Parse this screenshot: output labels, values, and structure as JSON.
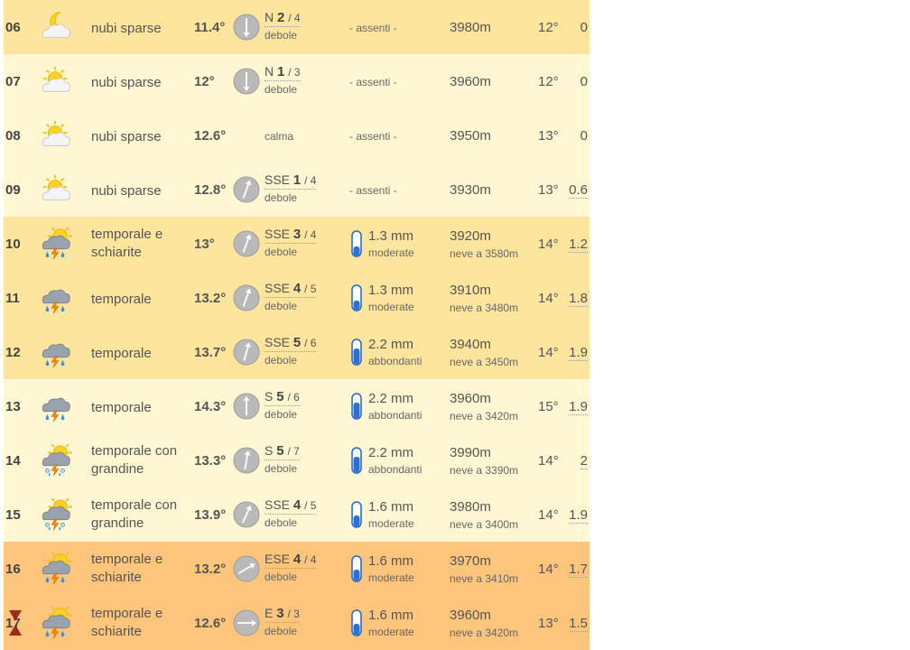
{
  "rows": [
    {
      "hour": "06",
      "icon": "moon-cloud-icon",
      "desc": "nubi sparse",
      "temp": "11.4°",
      "wind_angle": 180,
      "wind_dir": "N",
      "wind_speed": "2",
      "wind_gust": "/ 4",
      "wind_label": "debole",
      "rain": "- assenti -",
      "freeze": "3980m",
      "perc": "12°",
      "extra": "0",
      "tone": "t-gold"
    },
    {
      "hour": "07",
      "icon": "sun-cloud-icon",
      "desc": "nubi sparse",
      "temp": "12°",
      "wind_angle": 180,
      "wind_dir": "N",
      "wind_speed": "1",
      "wind_gust": "/ 3",
      "wind_label": "debole",
      "rain": "- assenti -",
      "freeze": "3960m",
      "perc": "12°",
      "extra": "0",
      "tone": "t-pale"
    },
    {
      "hour": "08",
      "icon": "sun-cloud-icon",
      "desc": "nubi sparse",
      "temp": "12.6°",
      "calm": "calma",
      "rain": "- assenti -",
      "freeze": "3950m",
      "perc": "13°",
      "extra": "0",
      "tone": "t-pale"
    },
    {
      "hour": "09",
      "icon": "sun-cloud-icon",
      "desc": "nubi sparse",
      "temp": "12.8°",
      "wind_angle": 20,
      "wind_dir": "SSE",
      "wind_speed": "1",
      "wind_gust": "/ 4",
      "wind_label": "debole",
      "rain": "- assenti -",
      "freeze": "3930m",
      "perc": "13°",
      "extra": "0.6",
      "extra_dotted": true,
      "tone": "t-pale"
    },
    {
      "hour": "10",
      "icon": "sun-storm-icon",
      "desc": "temporale e schiarite",
      "temp": "13°",
      "wind_angle": 20,
      "wind_dir": "SSE",
      "wind_speed": "3",
      "wind_gust": "/ 4",
      "wind_label": "debole",
      "rain_amt": "1.3 mm",
      "rain_int": "moderate",
      "rain_level": 0.4,
      "freeze": "3920m",
      "snow": "neve a 3580m",
      "perc": "14°",
      "extra": "1.2",
      "extra_dotted": true,
      "tone": "t-gold"
    },
    {
      "hour": "11",
      "icon": "storm-icon",
      "desc": "temporale",
      "temp": "13.2°",
      "wind_angle": 20,
      "wind_dir": "SSE",
      "wind_speed": "4",
      "wind_gust": "/ 5",
      "wind_label": "debole",
      "rain_amt": "1.3 mm",
      "rain_int": "moderate",
      "rain_level": 0.4,
      "freeze": "3910m",
      "snow": "neve a 3480m",
      "perc": "14°",
      "extra": "1.8",
      "extra_dotted": true,
      "tone": "t-gold"
    },
    {
      "hour": "12",
      "icon": "storm-icon",
      "desc": "temporale",
      "temp": "13.7°",
      "wind_angle": 15,
      "wind_dir": "SSE",
      "wind_speed": "5",
      "wind_gust": "/ 6",
      "wind_label": "debole",
      "rain_amt": "2.2 mm",
      "rain_int": "abbondanti",
      "rain_level": 0.65,
      "freeze": "3940m",
      "snow": "neve a 3450m",
      "perc": "14°",
      "extra": "1.9",
      "extra_dotted": true,
      "tone": "t-gold"
    },
    {
      "hour": "13",
      "icon": "storm-icon",
      "desc": "temporale",
      "temp": "14.3°",
      "wind_angle": 0,
      "wind_dir": "S",
      "wind_speed": "5",
      "wind_gust": "/ 6",
      "wind_label": "debole",
      "rain_amt": "2.2 mm",
      "rain_int": "abbondanti",
      "rain_level": 0.65,
      "freeze": "3960m",
      "snow": "neve a 3420m",
      "perc": "15°",
      "extra": "1.9",
      "extra_dotted": true,
      "tone": "t-pale"
    },
    {
      "hour": "14",
      "icon": "sun-hail-icon",
      "desc": "temporale con grandine",
      "temp": "13.3°",
      "wind_angle": 10,
      "wind_dir": "S",
      "wind_speed": "5",
      "wind_gust": "/ 7",
      "wind_label": "debole",
      "rain_amt": "2.2 mm",
      "rain_int": "abbondanti",
      "rain_level": 0.65,
      "freeze": "3990m",
      "snow": "neve a 3390m",
      "perc": "14°",
      "extra": "2",
      "extra_dotted": true,
      "tone": "t-pale"
    },
    {
      "hour": "15",
      "icon": "sun-hail-icon",
      "desc": "temporale con grandine",
      "temp": "13.9°",
      "wind_angle": 25,
      "wind_dir": "SSE",
      "wind_speed": "4",
      "wind_gust": "/ 5",
      "wind_label": "debole",
      "rain_amt": "1.6 mm",
      "rain_int": "moderate",
      "rain_level": 0.45,
      "freeze": "3980m",
      "snow": "neve a 3400m",
      "perc": "14°",
      "extra": "1.9",
      "extra_dotted": true,
      "tone": "t-pale"
    },
    {
      "hour": "16",
      "icon": "sun-storm-icon",
      "desc": "temporale e schiarite",
      "temp": "13.2°",
      "wind_angle": 60,
      "wind_dir": "ESE",
      "wind_speed": "4",
      "wind_gust": "/ 4",
      "wind_label": "debole",
      "rain_amt": "1.6 mm",
      "rain_int": "moderate",
      "rain_level": 0.45,
      "freeze": "3970m",
      "snow": "neve a 3410m",
      "perc": "14°",
      "extra": "1.7",
      "extra_dotted": true,
      "tone": "t-orange"
    },
    {
      "hour": "17",
      "icon": "sun-storm-icon",
      "desc": "temporale e schiarite",
      "temp": "12.6°",
      "wind_angle": 90,
      "wind_dir": "E",
      "wind_speed": "3",
      "wind_gust": "/ 3",
      "wind_label": "debole",
      "rain_amt": "1.6 mm",
      "rain_int": "moderate",
      "rain_level": 0.45,
      "freeze": "3960m",
      "snow": "neve a 3420m",
      "perc": "13°",
      "extra": "1.5",
      "extra_dotted": true,
      "tone": "t-orange",
      "marker": "sunset-marker-icon"
    }
  ]
}
